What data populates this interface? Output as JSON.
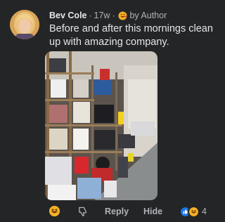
{
  "comment": {
    "author": "Bev Cole",
    "separator": "·",
    "timestamp": "17w",
    "badge_text": "by Author",
    "text": "Before and after this mornings clean up with amazing company."
  },
  "actions": {
    "reply_label": "Reply",
    "hide_label": "Hide",
    "reaction_count": "4",
    "reaction_icons": [
      "like-icon",
      "haha-icon"
    ]
  },
  "colors": {
    "background": "#242526",
    "text_primary": "#e4e6eb",
    "text_secondary": "#b0b3b8",
    "like_blue": "#1b74e4",
    "haha_yellow": "#f7b125"
  }
}
